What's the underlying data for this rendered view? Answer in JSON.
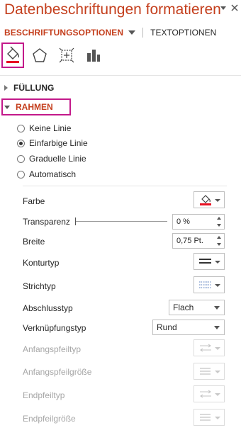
{
  "pane": {
    "title": "Datenbeschriftungen formatieren"
  },
  "tabs": {
    "active": "BESCHRIFTUNGSOPTIONEN",
    "other": "TEXTOPTIONEN"
  },
  "categories": {
    "icons": [
      "fill-line-icon",
      "effects-pentagon-icon",
      "size-properties-icon",
      "label-options-chart-icon"
    ]
  },
  "sections": {
    "fill": "FÜLLUNG",
    "border": "RAHMEN"
  },
  "line_options": [
    {
      "label": "Keine Linie",
      "selected": false
    },
    {
      "label": "Einfarbige Linie",
      "selected": true
    },
    {
      "label": "Graduelle Linie",
      "selected": false
    },
    {
      "label": "Automatisch",
      "selected": false
    }
  ],
  "properties": {
    "color": {
      "label": "Farbe",
      "swatch": "#e81123"
    },
    "transparency": {
      "label": "Transparenz",
      "value": "0 %",
      "level": 0
    },
    "width": {
      "label": "Breite",
      "value": "0,75 Pt."
    },
    "compound_type": {
      "label": "Konturtyp"
    },
    "dash_type": {
      "label": "Strichtyp"
    },
    "cap_type": {
      "label": "Abschlusstyp",
      "value": "Flach"
    },
    "join_type": {
      "label": "Verknüpfungstyp",
      "value": "Rund"
    },
    "begin_arrow_type": {
      "label": "Anfangspfeiltyp"
    },
    "begin_arrow_size": {
      "label": "Anfangspfeilgröße"
    },
    "end_arrow_type": {
      "label": "Endpfeiltyp"
    },
    "end_arrow_size": {
      "label": "Endpfeilgröße"
    }
  },
  "colors": {
    "accent": "#c43e1c",
    "highlight": "#c3198a"
  }
}
